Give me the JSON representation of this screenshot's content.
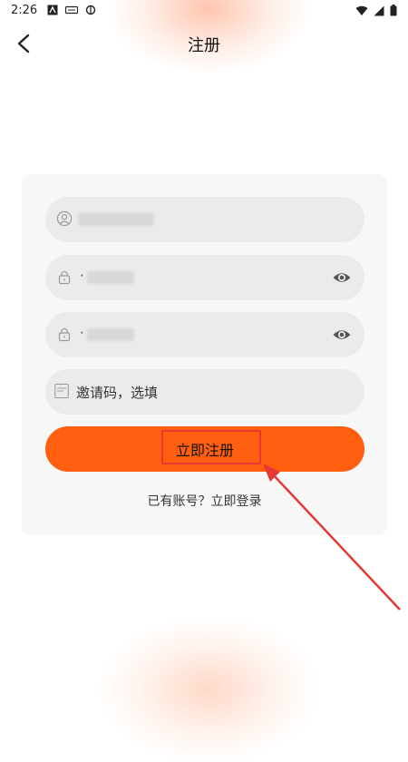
{
  "status_bar": {
    "time": "2:26",
    "left_icons": [
      "a-icon",
      "sim-icon",
      "notification-icon"
    ],
    "right_icons": [
      "wifi-icon",
      "signal-icon",
      "battery-icon"
    ]
  },
  "header": {
    "title": "注册",
    "back_icon": "back-arrow-icon"
  },
  "form": {
    "username": {
      "icon": "user-icon",
      "value": ""
    },
    "password": {
      "icon": "lock-icon",
      "value": "·",
      "toggle_icon": "eye-icon"
    },
    "confirm_password": {
      "icon": "lock-icon",
      "value": "·",
      "toggle_icon": "eye-icon"
    },
    "invite_code": {
      "icon": "invite-icon",
      "placeholder": "邀请码，选填"
    },
    "register_label": "立即注册",
    "login_link": "已有账号？立即登录"
  },
  "colors": {
    "accent": "#ff5f0e",
    "annotation": "#e53935",
    "card_bg": "#f7f7f7",
    "field_bg": "#ebebeb"
  }
}
